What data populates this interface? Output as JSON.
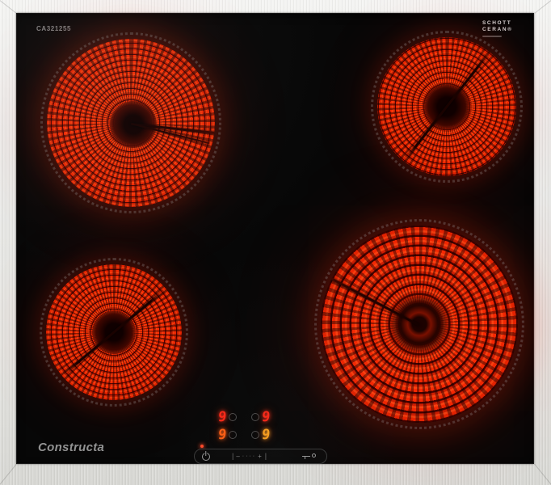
{
  "product": {
    "brand": "Constructa",
    "model": "CA321255",
    "glass_logo_line1": "SCHOTT",
    "glass_logo_line2": "CERAN®"
  },
  "display": {
    "zones": [
      {
        "position": "rear-left",
        "level": "9"
      },
      {
        "position": "rear-right",
        "level": "9"
      },
      {
        "position": "front-left",
        "level": "9"
      },
      {
        "position": "front-right",
        "level": "9"
      }
    ]
  },
  "controls": {
    "divider": "|",
    "slider_minus": "–",
    "slider_dots": "····",
    "slider_plus": "+",
    "power_icon": "standby-power-icon",
    "lock_icon": "key-lock-icon",
    "indicator_led": "on"
  },
  "burners": [
    {
      "position": "rear-left",
      "size": "large",
      "state": "on"
    },
    {
      "position": "rear-right",
      "size": "medium",
      "state": "on"
    },
    {
      "position": "front-left",
      "size": "small",
      "state": "on"
    },
    {
      "position": "front-right",
      "size": "extra-large",
      "state": "on"
    }
  ],
  "colors": {
    "coil_glow": "#ff3104",
    "digit_red": "#ff2918",
    "digit_orange": "#ff5f14",
    "digit_amber": "#ffa21e",
    "frame_metal": "#e9e9e7",
    "glass_black": "#070707"
  }
}
